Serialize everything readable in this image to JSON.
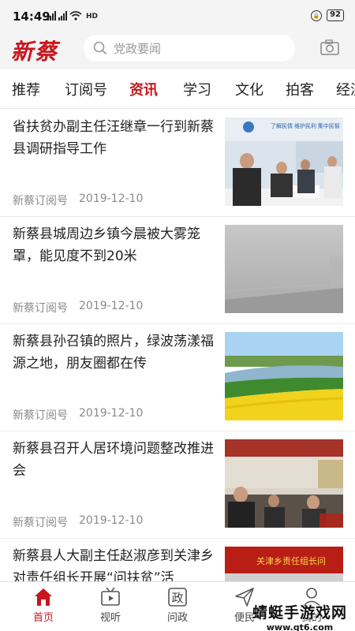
{
  "status": {
    "time": "14:49",
    "network": "HD",
    "battery": "92"
  },
  "header": {
    "logo": "新蔡",
    "search_placeholder": "党政要闻"
  },
  "tabs": [
    "推荐",
    "订阅号",
    "资讯",
    "学习",
    "文化",
    "拍客",
    "经济"
  ],
  "active_tab": "资讯",
  "feed": [
    {
      "title": "省扶贫办副主任汪继章一行到新蔡县调研指导工作",
      "source": "新蔡订阅号",
      "date": "2019-12-10",
      "thumb_text": "了解民情  维护民利  集中民智"
    },
    {
      "title": "新蔡县城周边乡镇今晨被大雾笼罩，能见度不到20米",
      "source": "新蔡订阅号",
      "date": "2019-12-10"
    },
    {
      "title": "新蔡县孙召镇的照片，绿波荡漾福源之地，朋友圈都在传",
      "source": "新蔡订阅号",
      "date": "2019-12-10"
    },
    {
      "title": "新蔡县召开人居环境问题整改推进会",
      "source": "新蔡订阅号",
      "date": "2019-12-10"
    },
    {
      "title": "新蔡县人大副主任赵淑彦到关津乡对责任组长开展“问扶贫”活",
      "source": "",
      "date": "",
      "thumb_text": "关津乡责任组长问"
    }
  ],
  "bottom_nav": [
    {
      "label": "首页",
      "icon": "home-icon"
    },
    {
      "label": "视听",
      "icon": "tv-icon"
    },
    {
      "label": "问政",
      "icon": "wenzheng-icon",
      "icon_text": "政"
    },
    {
      "label": "便民",
      "icon": "send-icon"
    },
    {
      "label": "我的",
      "icon": "user-icon"
    }
  ],
  "watermark": {
    "text": "蜻蜓手游戏网",
    "url": "www.qt6.com"
  },
  "colors": {
    "accent": "#c8161d",
    "statusbar": "#f4f4f4"
  }
}
